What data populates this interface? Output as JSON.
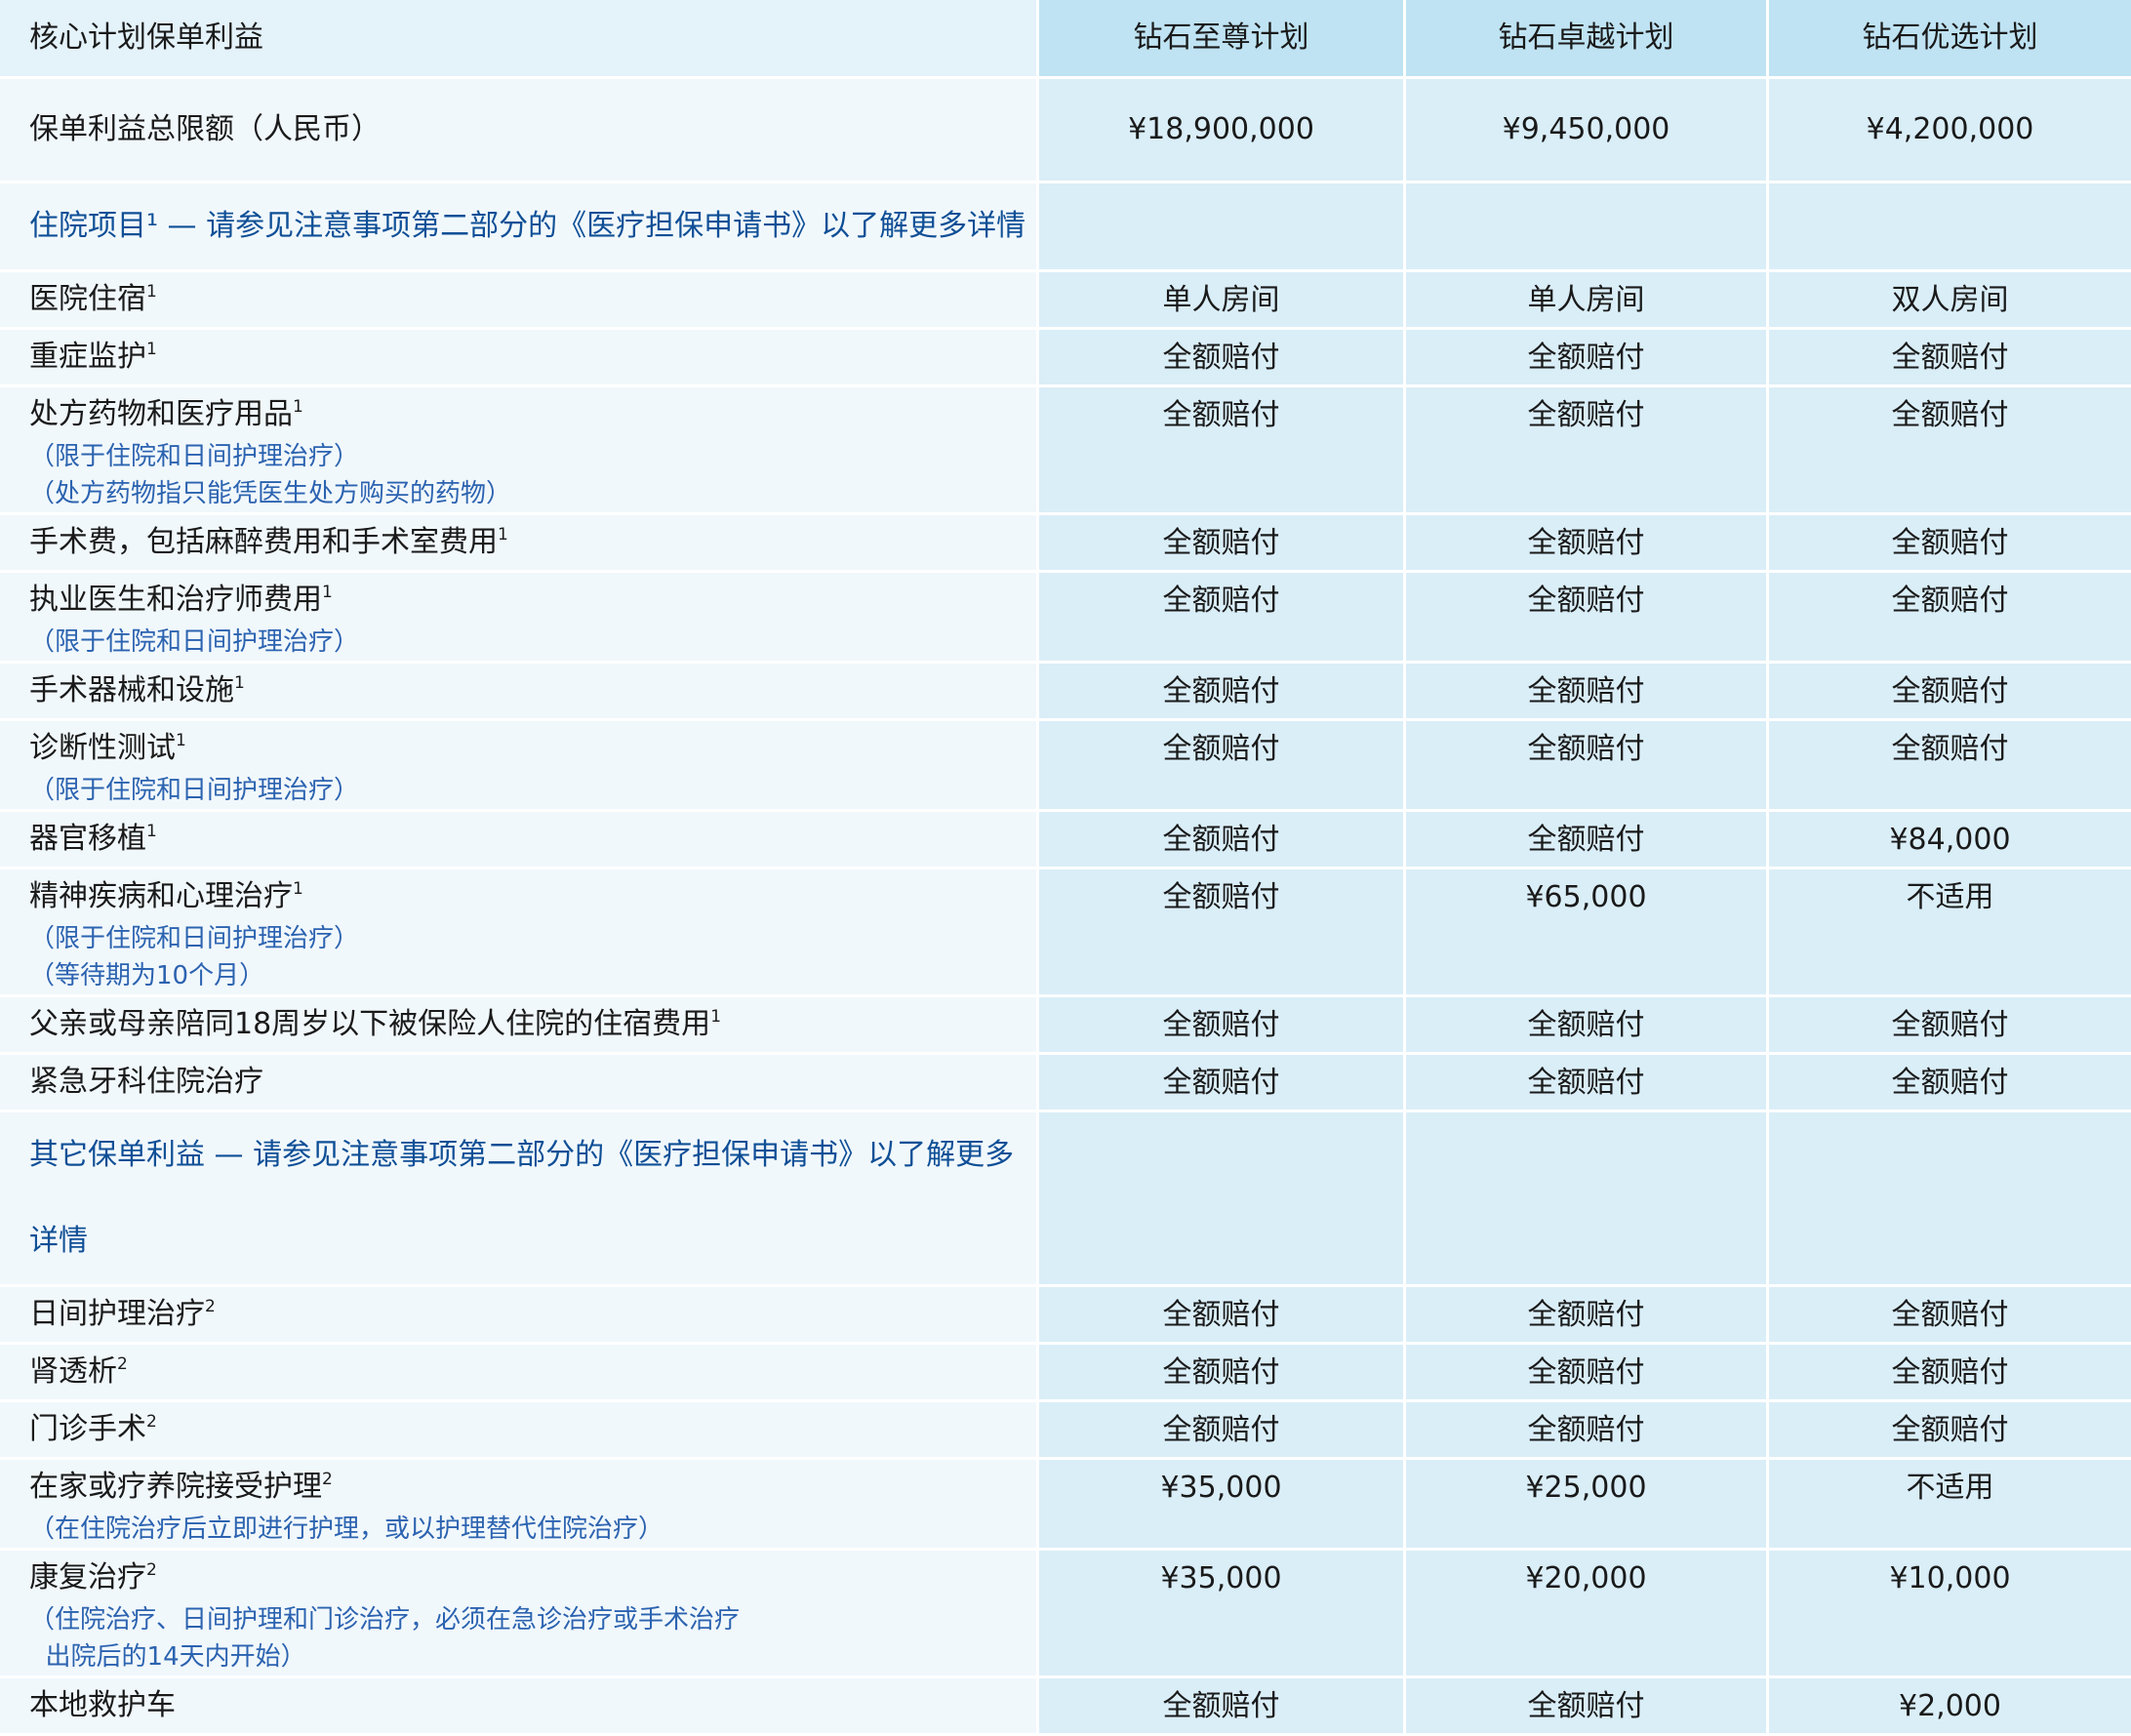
{
  "header": {
    "title": "核心计划保单利益",
    "plans": [
      "钻石至尊计划",
      "钻石卓越计划",
      "钻石优选计划"
    ]
  },
  "total": {
    "label": "保单利益总限额（人民币）",
    "values": [
      "¥18,900,000",
      "¥9,450,000",
      "¥4,200,000"
    ]
  },
  "sections": [
    {
      "title": "住院项目¹ — 请参见注意事项第二部分的《医疗担保申请书》以了解更多详情",
      "rows": [
        {
          "label": "医院住宿",
          "sup": "1",
          "notes": [],
          "values": [
            "单人房间",
            "单人房间",
            "双人房间"
          ]
        },
        {
          "label": "重症监护",
          "sup": "1",
          "notes": [],
          "values": [
            "全额赔付",
            "全额赔付",
            "全额赔付"
          ]
        },
        {
          "label": "处方药物和医疗用品",
          "sup": "1",
          "notes": [
            "（限于住院和日间护理治疗）",
            "（处方药物指只能凭医生处方购买的药物）"
          ],
          "values": [
            "全额赔付",
            "全额赔付",
            "全额赔付"
          ]
        },
        {
          "label": "手术费，包括麻醉费用和手术室费用",
          "sup": "1",
          "notes": [],
          "values": [
            "全额赔付",
            "全额赔付",
            "全额赔付"
          ]
        },
        {
          "label": "执业医生和治疗师费用",
          "sup": "1",
          "notes": [
            "（限于住院和日间护理治疗）"
          ],
          "values": [
            "全额赔付",
            "全额赔付",
            "全额赔付"
          ]
        },
        {
          "label": "手术器械和设施",
          "sup": "1",
          "notes": [],
          "values": [
            "全额赔付",
            "全额赔付",
            "全额赔付"
          ]
        },
        {
          "label": "诊断性测试",
          "sup": "1",
          "notes": [
            "（限于住院和日间护理治疗）"
          ],
          "values": [
            "全额赔付",
            "全额赔付",
            "全额赔付"
          ]
        },
        {
          "label": "器官移植",
          "sup": "1",
          "notes": [],
          "values": [
            "全额赔付",
            "全额赔付",
            "¥84,000"
          ]
        },
        {
          "label": "精神疾病和心理治疗",
          "sup": "1",
          "notes": [
            "（限于住院和日间护理治疗）",
            "（等待期为10个月）"
          ],
          "values": [
            "全额赔付",
            "¥65,000",
            "不适用"
          ]
        },
        {
          "label": "父亲或母亲陪同18周岁以下被保险人住院的住宿费用",
          "sup": "1",
          "notes": [],
          "values": [
            "全额赔付",
            "全额赔付",
            "全额赔付"
          ]
        },
        {
          "label": "紧急牙科住院治疗",
          "sup": "",
          "notes": [],
          "values": [
            "全额赔付",
            "全额赔付",
            "全额赔付"
          ]
        }
      ]
    },
    {
      "title": "其它保单利益 — 请参见注意事项第二部分的《医疗担保申请书》以了解更多详情",
      "rows": [
        {
          "label": "日间护理治疗",
          "sup": "2",
          "notes": [],
          "values": [
            "全额赔付",
            "全额赔付",
            "全额赔付"
          ]
        },
        {
          "label": "肾透析",
          "sup": "2",
          "notes": [],
          "values": [
            "全额赔付",
            "全额赔付",
            "全额赔付"
          ]
        },
        {
          "label": "门诊手术",
          "sup": "2",
          "notes": [],
          "values": [
            "全额赔付",
            "全额赔付",
            "全额赔付"
          ]
        },
        {
          "label": "在家或疗养院接受护理",
          "sup": "2",
          "notes": [
            "（在住院治疗后立即进行护理，或以护理替代住院治疗）"
          ],
          "values": [
            "¥35,000",
            "¥25,000",
            "不适用"
          ]
        },
        {
          "label": "康复治疗",
          "sup": "2",
          "notes": [
            "（住院治疗、日间护理和门诊治疗，必须在急诊治疗或手术治疗",
            "  出院后的14天内开始）"
          ],
          "values": [
            "¥35,000",
            "¥20,000",
            "¥10,000"
          ]
        },
        {
          "label": "本地救护车",
          "sup": "",
          "notes": [],
          "values": [
            "全额赔付",
            "全额赔付",
            "¥2,000"
          ]
        }
      ]
    }
  ]
}
